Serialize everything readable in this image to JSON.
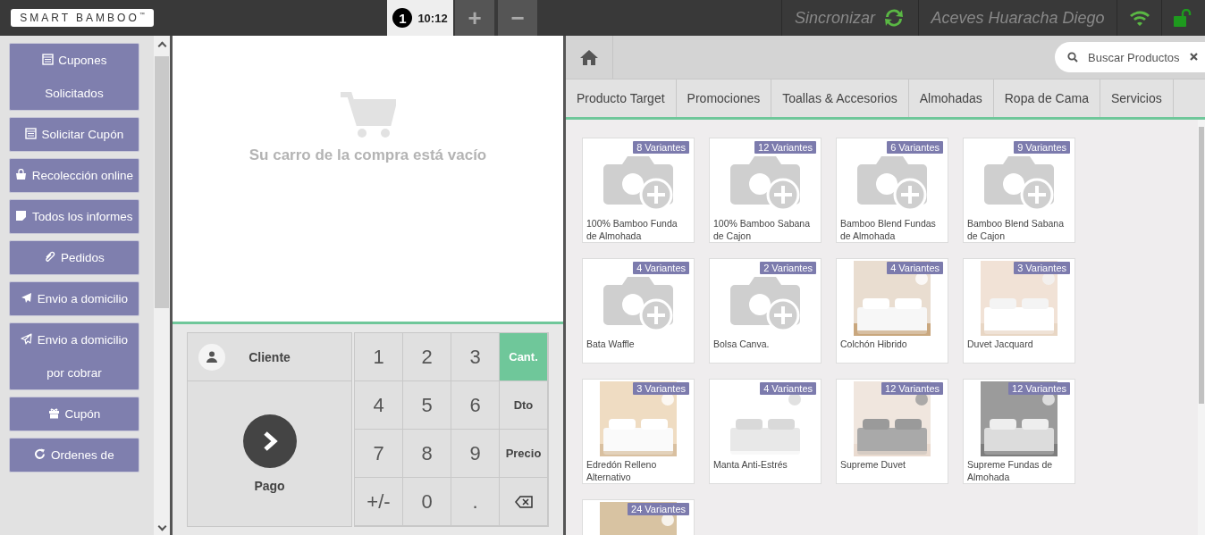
{
  "topbar": {
    "logo": "SMART BAMBOO",
    "logo_mark": "™",
    "orders": [
      {
        "number": "1",
        "time": "10:12",
        "selected": true
      }
    ],
    "order_buttons": [
      "+",
      "−"
    ],
    "sync": "Sincronizar",
    "user": "Aceves Huaracha Diego",
    "online": true,
    "unlocked": true
  },
  "sidebar": {
    "items": [
      {
        "label": "Cupones Solicitados"
      },
      {
        "label": "Solicitar Cupón"
      },
      {
        "label": "Recolección online"
      },
      {
        "label": "Todos los informes"
      },
      {
        "label": "Pedidos"
      },
      {
        "label": "Envio a domicilio"
      },
      {
        "label": "Envio a domicilio por cobrar"
      },
      {
        "label": "Cupón"
      },
      {
        "label": "Ordenes de"
      }
    ]
  },
  "cart": {
    "empty_message": "Su carro de la compra está vacío"
  },
  "actions": {
    "customer": "Cliente",
    "payment": "Pago"
  },
  "keypad": [
    {
      "kind": "digit",
      "label": "1"
    },
    {
      "kind": "digit",
      "label": "2"
    },
    {
      "kind": "digit",
      "label": "3"
    },
    {
      "kind": "mode",
      "label": "Cant.",
      "selected": true
    },
    {
      "kind": "digit",
      "label": "4"
    },
    {
      "kind": "digit",
      "label": "5"
    },
    {
      "kind": "digit",
      "label": "6"
    },
    {
      "kind": "mode",
      "label": "Dto",
      "selected": false
    },
    {
      "kind": "digit",
      "label": "7"
    },
    {
      "kind": "digit",
      "label": "8"
    },
    {
      "kind": "digit",
      "label": "9"
    },
    {
      "kind": "mode",
      "label": "Precio",
      "selected": false
    },
    {
      "kind": "digit",
      "label": "+/-"
    },
    {
      "kind": "digit",
      "label": "0"
    },
    {
      "kind": "digit",
      "label": "."
    },
    {
      "kind": "backspace"
    }
  ],
  "products_panel": {
    "search": {
      "placeholder": "Buscar Productos"
    },
    "categories": [
      "Producto Target",
      "Promociones",
      "Toallas & Accesorios",
      "Almohadas",
      "Ropa de Cama",
      "Servicios"
    ],
    "products": [
      {
        "name": "100% Bamboo Funda de Almohada",
        "variants": "8 Variantes",
        "kind": "placeholder"
      },
      {
        "name": "100% Bamboo Sabana de Cajon",
        "variants": "12 Variantes",
        "kind": "placeholder"
      },
      {
        "name": "Bamboo Blend Fundas de Almohada",
        "variants": "6 Variantes",
        "kind": "placeholder"
      },
      {
        "name": "Bamboo Blend Sabana de Cajon",
        "variants": "9 Variantes",
        "kind": "placeholder"
      },
      {
        "name": "Bata Waffle",
        "variants": "4 Variantes",
        "kind": "placeholder"
      },
      {
        "name": "Bolsa Canva.",
        "variants": "2 Variantes",
        "kind": "placeholder"
      },
      {
        "name": "Colchón Hibrido",
        "variants": "4 Variantes",
        "kind": "picture"
      },
      {
        "name": "Duvet Jacquard",
        "variants": "3 Variantes",
        "kind": "picture"
      },
      {
        "name": "Edredón Relleno Alternativo",
        "variants": "3 Variantes",
        "kind": "picture"
      },
      {
        "name": "Manta Anti-Estrés",
        "variants": "4 Variantes",
        "kind": "picture"
      },
      {
        "name": "Supreme Duvet",
        "variants": "12 Variantes",
        "kind": "picture"
      },
      {
        "name": "Supreme Fundas de Almohada",
        "variants": "12 Variantes",
        "kind": "picture"
      },
      {
        "variants": "24 Variantes",
        "kind": "picture"
      }
    ]
  }
}
